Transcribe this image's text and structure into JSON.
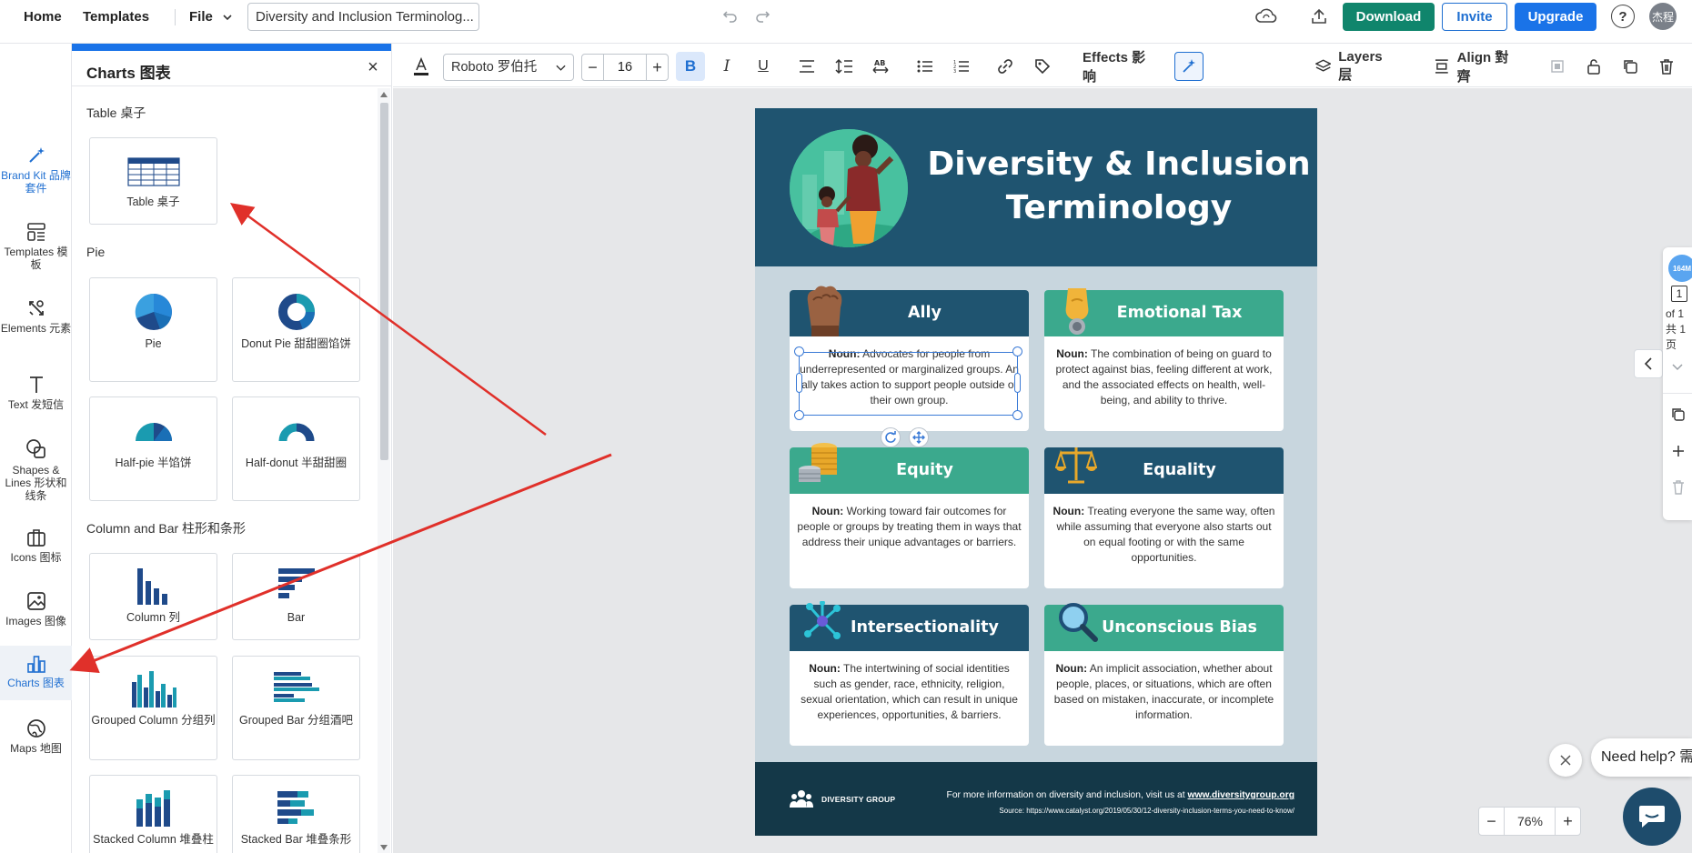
{
  "topbar": {
    "home": "Home",
    "templates": "Templates",
    "file": "File",
    "doc_title": "Diversity and Inclusion Terminolog...",
    "download": "Download",
    "invite": "Invite",
    "upgrade": "Upgrade",
    "help": "?",
    "avatar": "杰程"
  },
  "rail": {
    "items": [
      {
        "label": "Brand Kit 品牌套件",
        "icon": "magic-wand-icon"
      },
      {
        "label": "Templates 模板",
        "icon": "templates-icon"
      },
      {
        "label": "Elements 元素",
        "icon": "elements-icon"
      },
      {
        "label": "Text 发短信",
        "icon": "text-icon"
      },
      {
        "label": "Shapes & Lines 形状和线条",
        "icon": "shapes-icon"
      },
      {
        "label": "Icons 图标",
        "icon": "briefcase-icon"
      },
      {
        "label": "Images 图像",
        "icon": "image-icon"
      },
      {
        "label": "Charts 图表",
        "icon": "chart-icon"
      },
      {
        "label": "Maps 地图",
        "icon": "globe-icon"
      }
    ]
  },
  "panel": {
    "title": "Charts 图表",
    "sections": {
      "table": "Table 桌子",
      "pie": "Pie",
      "column_bar": "Column and Bar 柱形和条形"
    },
    "cards": {
      "table": "Table 桌子",
      "pie": "Pie",
      "donut": "Donut Pie 甜甜圈馅饼",
      "half_pie": "Half-pie 半馅饼",
      "half_donut": "Half-donut 半甜甜圈",
      "column": "Column 列",
      "bar": "Bar",
      "grouped_column": "Grouped Column 分组列",
      "grouped_bar": "Grouped Bar 分组酒吧",
      "stacked_column": "Stacked Column 堆叠柱",
      "stacked_bar": "Stacked Bar 堆叠条形"
    }
  },
  "format": {
    "font": "Roboto 罗伯托",
    "size": "16",
    "effects": "Effects 影响",
    "layers": "Layers 层",
    "align": "Align 對齊"
  },
  "poster": {
    "title_line1": "Diversity & Inclusion",
    "title_line2": "Terminology",
    "cards": [
      {
        "title": "Ally",
        "noun": "Noun:",
        "text": "Advocates for people from underrepresented or marginalized groups. An ally takes action to support people outside of their own group."
      },
      {
        "title": "Emotional Tax",
        "noun": "Noun:",
        "text": "The combination of being on guard to protect against bias, feeling different at work, and the associated effects on health, well-being, and ability to thrive."
      },
      {
        "title": "Equity",
        "noun": "Noun:",
        "text": "Working toward fair outcomes for people or groups by treating them in ways that address their unique advantages or barriers."
      },
      {
        "title": "Equality",
        "noun": "Noun:",
        "text": "Treating everyone the same way, often while assuming that everyone also starts out on equal footing or with the same opportunities."
      },
      {
        "title": "Intersectionality",
        "noun": "Noun:",
        "text": "The intertwining of social identities such as gender, race, ethnicity, religion, sexual orientation, which can result in unique experiences, opportunities, & barriers."
      },
      {
        "title": "Unconscious Bias",
        "noun": "Noun:",
        "text": "An implicit association, whether about people, places, or situations, which are often based on mistaken, inaccurate, or incomplete information."
      }
    ],
    "footer": {
      "brand": "DIVERSITY GROUP",
      "info_prefix": "For more information on diversity and inclusion, visit us at",
      "info_link": "www.diversitygroup.org",
      "source": "Source: https://www.catalyst.org/2019/05/30/12-diversity-inclusion-terms-you-need-to-know/"
    }
  },
  "pagerail": {
    "size_badge": "164M",
    "page": "1",
    "of_text": "of 1 共 1 页"
  },
  "zoom": {
    "minus": "−",
    "value": "76%",
    "plus": "+"
  },
  "help": {
    "bubble": "Need help? 需"
  },
  "colors": {
    "brand_green": "#10856c",
    "accent_blue": "#1a73e8",
    "poster_navy": "#1f5470",
    "poster_teal": "#3ba98d",
    "annotation_red": "#e0302a"
  }
}
